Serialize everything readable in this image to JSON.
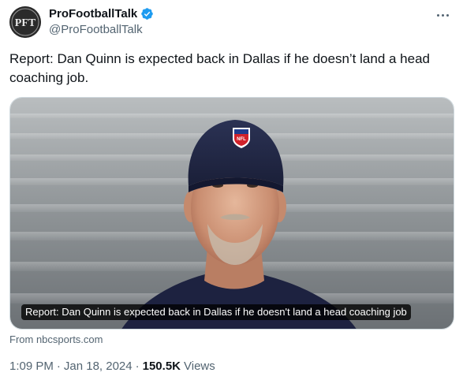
{
  "account": {
    "avatar_text": "PFT",
    "display_name": "ProFootballTalk",
    "handle": "@ProFootballTalk",
    "verified_color": "#1d9bf0"
  },
  "tweet": {
    "text": "Report: Dan Quinn is expected back in Dallas if he doesn’t land a head coaching job."
  },
  "media_card": {
    "caption": "Report: Dan Quinn is expected back in Dallas if he doesn't land a head coaching job",
    "cap_logo_text": "NFL",
    "source": "From nbcsports.com"
  },
  "meta": {
    "time": "1:09 PM",
    "sep1": "·",
    "date": "Jan 18, 2024",
    "sep2": "·",
    "views_count": "150.5K",
    "views_label": "Views"
  },
  "icons": {
    "verified": "verified-badge-icon",
    "more": "more-options-icon"
  }
}
